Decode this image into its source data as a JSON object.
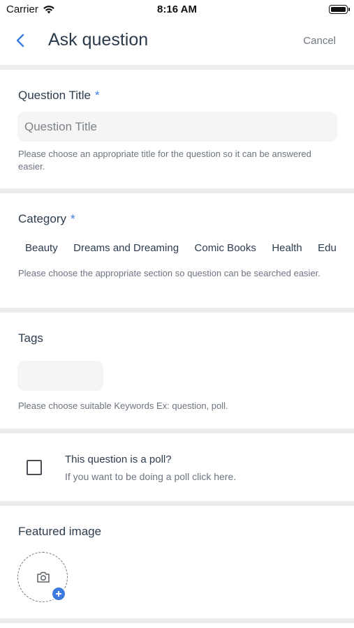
{
  "status_bar": {
    "carrier": "Carrier",
    "time": "8:16 AM",
    "wifi_icon": "wifi-icon",
    "battery_icon": "battery-icon"
  },
  "nav": {
    "title": "Ask question",
    "cancel_label": "Cancel",
    "back_icon": "chevron-left-icon"
  },
  "question_title": {
    "label": "Question Title",
    "required_mark": "*",
    "placeholder": "Question Title",
    "value": "",
    "hint": "Please choose an appropriate title for the question so it can be answered easier."
  },
  "category": {
    "label": "Category",
    "required_mark": "*",
    "options": [
      "Beauty",
      "Dreams and Dreaming",
      "Comic Books",
      "Health",
      "Edu"
    ],
    "hint": "Please choose the appropriate section so question can be searched easier."
  },
  "tags": {
    "label": "Tags",
    "value": "",
    "hint": "Please choose suitable Keywords Ex: question, poll."
  },
  "poll": {
    "checked": false,
    "title": "This question is a poll?",
    "subtitle": "If you want to be doing a poll click here."
  },
  "featured_image": {
    "label": "Featured image",
    "camera_icon": "camera-icon",
    "add_icon": "plus-icon"
  },
  "colors": {
    "accent": "#3c7bdc",
    "separator": "#ededed",
    "input_bg": "#f5f5f5",
    "text": "#2d3c4d",
    "hint": "#6c7480"
  }
}
